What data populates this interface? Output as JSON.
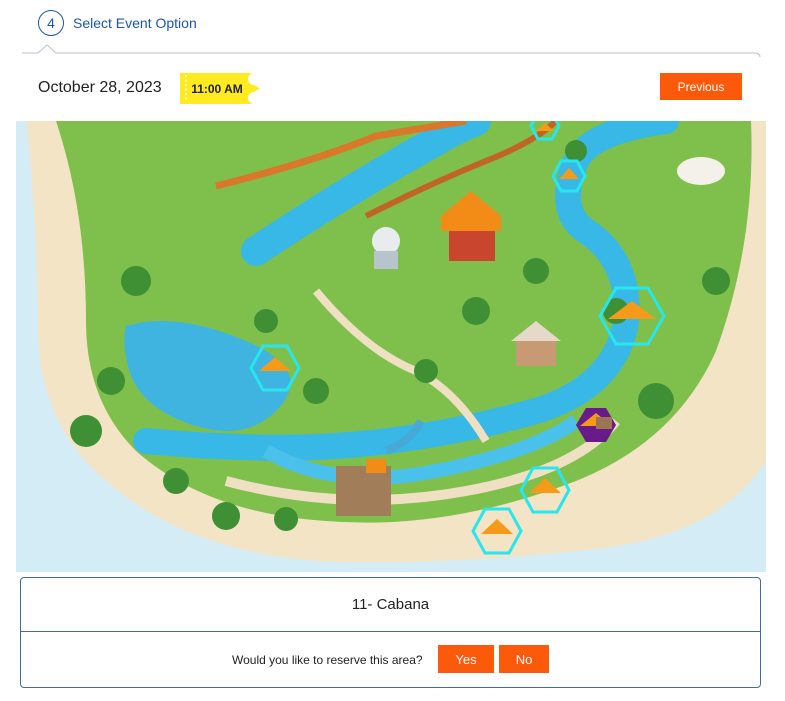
{
  "step": {
    "number": "4",
    "title": "Select Event Option"
  },
  "event": {
    "date": "October 28, 2023",
    "time": "11:00 AM"
  },
  "buttons": {
    "previous": "Previous",
    "yes": "Yes",
    "no": "No"
  },
  "selection": {
    "area_name": "11- Cabana",
    "question": "Would you like to reserve this area?"
  },
  "colors": {
    "accent": "#1a56b8",
    "button": "#fb5a0a",
    "ticket": "#ffeb1f",
    "available_outline": "#27e6ee",
    "selected_outline": "#6a1b8a"
  },
  "map": {
    "icon": "water-park-map"
  }
}
